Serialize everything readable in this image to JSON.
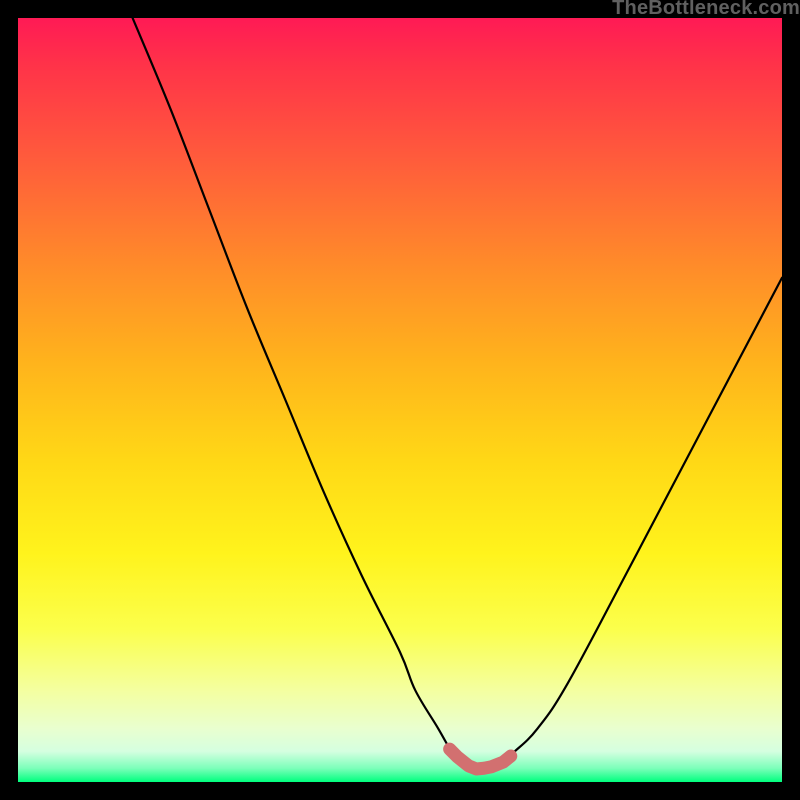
{
  "watermark": {
    "text": "TheBottleneck.com"
  },
  "colors": {
    "curve": "#000000",
    "marker": "#d27070",
    "background_black": "#000000"
  },
  "chart_data": {
    "type": "line",
    "title": "",
    "xlabel": "",
    "ylabel": "",
    "xlim": [
      0,
      100
    ],
    "ylim": [
      0,
      100
    ],
    "grid": false,
    "series": [
      {
        "name": "bottleneck-curve",
        "x": [
          15,
          20,
          25,
          30,
          35,
          40,
          45,
          50,
          52,
          55,
          57,
          58,
          59,
          60,
          60.5,
          61,
          63,
          65,
          68,
          72,
          80,
          90,
          100
        ],
        "y": [
          100,
          88,
          75,
          62,
          50,
          38,
          27,
          17,
          12,
          7,
          3.5,
          2.3,
          1.8,
          1.6,
          1.6,
          1.7,
          2.5,
          4,
          7,
          13,
          28,
          47,
          66
        ]
      }
    ],
    "markers": {
      "name": "highlight-region",
      "color": "#d27070",
      "x": [
        56.5,
        57.5,
        58.5,
        59.0,
        60.0,
        61.0,
        62.0,
        63.5,
        64.5
      ],
      "y": [
        4.3,
        3.3,
        2.5,
        2.1,
        1.7,
        1.8,
        2.0,
        2.6,
        3.4
      ]
    }
  }
}
